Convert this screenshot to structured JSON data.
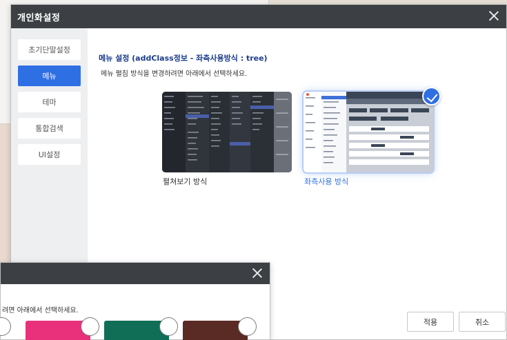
{
  "dialog": {
    "title": "개인화설정",
    "sidebar": [
      {
        "label": "초기단말설정",
        "active": false
      },
      {
        "label": "메뉴",
        "active": true
      },
      {
        "label": "테마",
        "active": false
      },
      {
        "label": "통합검색",
        "active": false
      },
      {
        "label": "UI설정",
        "active": false
      }
    ],
    "section_title": "메뉴 설정 (addClass정보 - 좌측사용방식 : tree)",
    "section_desc": "메뉴 펼침 방식을 변경하려면 아래에서 선택하세요.",
    "options": [
      {
        "label": "펼쳐보기 방식",
        "selected": false
      },
      {
        "label": "좌측사용 방식",
        "selected": true
      }
    ],
    "apply_label": "적용",
    "cancel_label": "취소"
  },
  "dialog2": {
    "desc": "려면 아래에서 선택하세요.",
    "swatches": [
      "#e8317a",
      "#0f6e55",
      "#5a2a25"
    ]
  },
  "colors": {
    "accent": "#2f6fe4",
    "header": "#3c4044",
    "title_text": "#1b3c8c"
  }
}
